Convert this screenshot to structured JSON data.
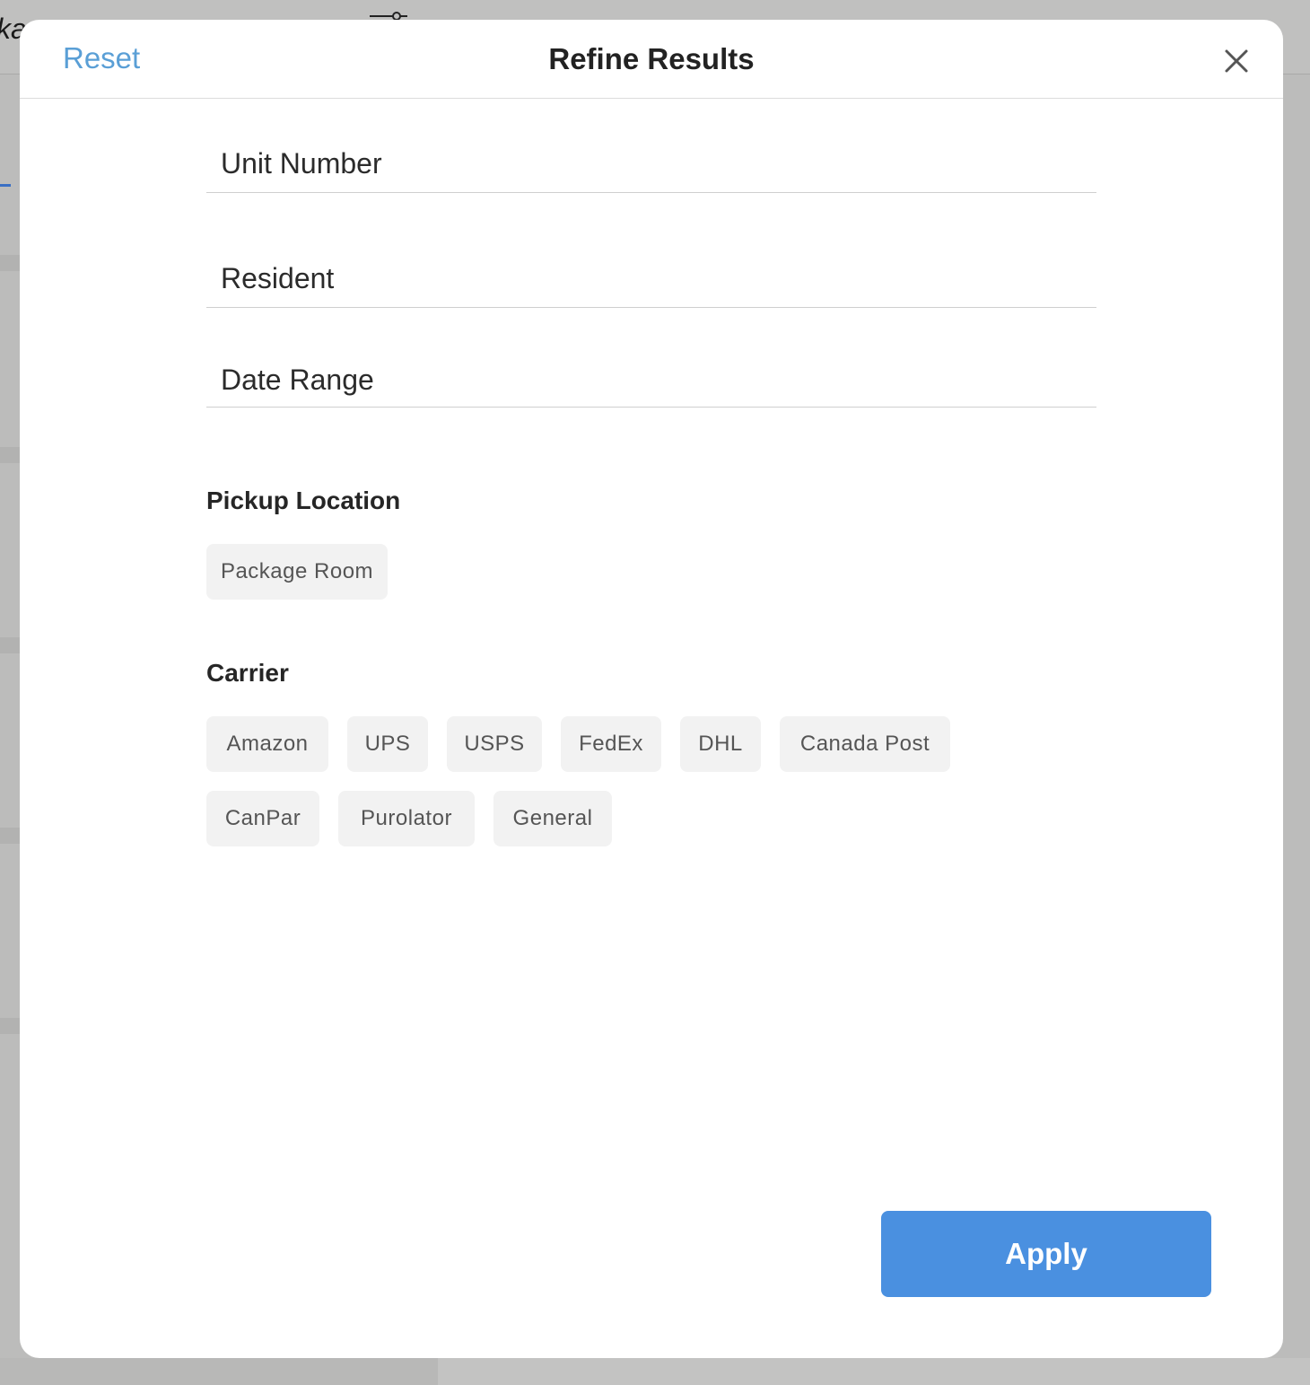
{
  "background": {
    "title_fragment": "ka",
    "filter_icon": "sliders-icon"
  },
  "modal": {
    "title": "Refine Results",
    "reset_label": "Reset",
    "close_icon": "close-icon",
    "fields": {
      "unit_number": {
        "placeholder": "Unit Number",
        "value": ""
      },
      "resident": {
        "placeholder": "Resident",
        "value": ""
      },
      "date_range": {
        "placeholder": "Date Range",
        "value": ""
      }
    },
    "pickup_location": {
      "label": "Pickup Location",
      "options": [
        "Package Room"
      ]
    },
    "carrier": {
      "label": "Carrier",
      "options": [
        "Amazon",
        "UPS",
        "USPS",
        "FedEx",
        "DHL",
        "Canada Post",
        "CanPar",
        "Purolator",
        "General"
      ]
    },
    "apply_label": "Apply"
  },
  "colors": {
    "accent": "#4a90e0",
    "link": "#5a9fd6",
    "chip_bg": "#f2f2f2",
    "overlay": "#bcbcbb"
  }
}
